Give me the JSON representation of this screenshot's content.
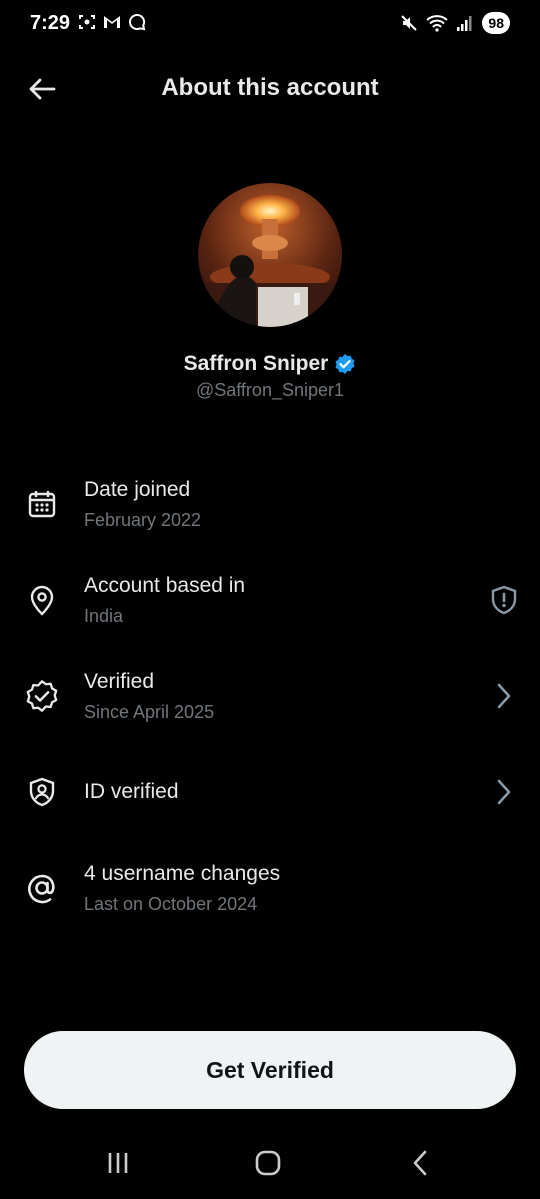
{
  "status_bar": {
    "time": "7:29",
    "left_icons": [
      "screenshot-icon",
      "gmail-icon",
      "chat-bubble-icon"
    ],
    "right_icons": [
      "mute-icon",
      "wifi-icon",
      "signal-icon"
    ],
    "battery": "98"
  },
  "header": {
    "title": "About this account",
    "back_icon": "back-arrow-icon"
  },
  "profile": {
    "display_name": "Saffron Sniper",
    "handle": "@Saffron_Sniper1",
    "verified_badge_color": "#1d9bf0"
  },
  "info_rows": [
    {
      "icon": "calendar-icon",
      "title": "Date joined",
      "subtitle": "February 2022"
    },
    {
      "icon": "location-pin-icon",
      "title": "Account based in",
      "subtitle": "India",
      "right_icon": "shield-alert-icon"
    },
    {
      "icon": "verified-badge-outline-icon",
      "title": "Verified",
      "subtitle": "Since April 2025",
      "right_icon": "chevron-right-icon"
    },
    {
      "icon": "id-shield-icon",
      "title": "ID verified",
      "subtitle": "",
      "right_icon": "chevron-right-icon"
    },
    {
      "icon": "at-sign-icon",
      "title": "4 username changes",
      "subtitle": "Last on October 2024"
    }
  ],
  "cta": {
    "label": "Get Verified"
  },
  "nav_bar": {
    "icons": [
      "recents-icon",
      "home-icon",
      "back-icon"
    ]
  },
  "colors": {
    "background": "#000000",
    "primary_text": "#e7e9ea",
    "secondary_text": "#71767b",
    "button_bg": "#eff3f4"
  }
}
